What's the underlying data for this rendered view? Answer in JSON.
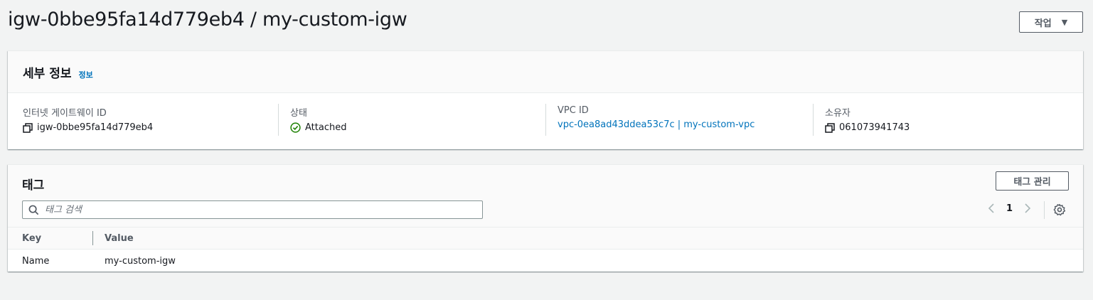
{
  "header": {
    "title": "igw-0bbe95fa14d779eb4 / my-custom-igw",
    "actions_label": "작업",
    "actions_caret": "▼"
  },
  "details": {
    "title": "세부 정보",
    "info_link": "정보",
    "fields": [
      {
        "label": "인터넷 게이트웨이 ID",
        "value": "igw-0bbe95fa14d779eb4",
        "icon": "copy-icon"
      },
      {
        "label": "상태",
        "value": "Attached",
        "icon": "check-circle-icon"
      },
      {
        "label": "VPC ID",
        "value": "vpc-0ea8ad43ddea53c7c | my-custom-vpc"
      },
      {
        "label": "소유자",
        "value": "061073941743",
        "icon": "copy-icon"
      }
    ]
  },
  "tags": {
    "title": "태그",
    "manage_label": "태그 관리",
    "search_placeholder": "태그 검색",
    "page": "1",
    "columns": [
      "Key",
      "Value"
    ],
    "rows": [
      {
        "key": "Name",
        "value": "my-custom-igw"
      }
    ]
  },
  "colors": {
    "accent_link": "#0073bb",
    "status_ok": "#1d8102",
    "background": "#f2f3f3"
  }
}
